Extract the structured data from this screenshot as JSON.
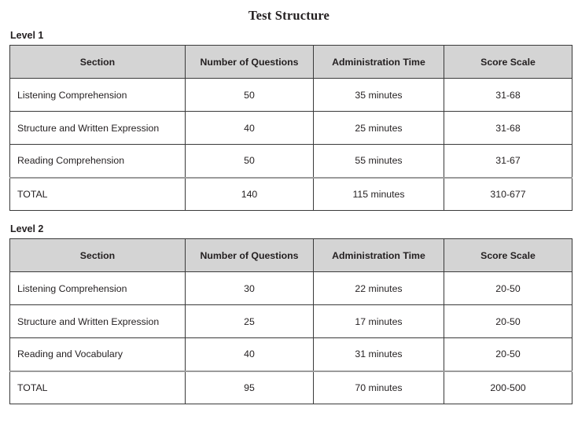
{
  "document": {
    "title": "Test Structure"
  },
  "colors": {
    "header_background": "#d4d4d4",
    "border": "#3a3a3a",
    "total_separator": "#9b9b9b",
    "text": "#231f20",
    "page_background": "#ffffff"
  },
  "columns": [
    "Section",
    "Number of Questions",
    "Administration Time",
    "Score Scale"
  ],
  "tables": [
    {
      "label": "Level 1",
      "headers": [
        "Section",
        "Number of Questions",
        "Administration Time",
        "Score Scale"
      ],
      "rows": [
        {
          "section": "Listening Comprehension",
          "questions": "50",
          "time": "35 minutes",
          "scale": "31-68"
        },
        {
          "section": "Structure and Written Expression",
          "questions": "40",
          "time": "25 minutes",
          "scale": "31-68"
        },
        {
          "section": "Reading Comprehension",
          "questions": "50",
          "time": "55 minutes",
          "scale": "31-67"
        }
      ],
      "total": {
        "section": "TOTAL",
        "questions": "140",
        "time": "115 minutes",
        "scale": "310-677"
      }
    },
    {
      "label": "Level 2",
      "headers": [
        "Section",
        "Number of Questions",
        "Administration Time",
        "Score Scale"
      ],
      "rows": [
        {
          "section": "Listening Comprehension",
          "questions": "30",
          "time": "22 minutes",
          "scale": "20-50"
        },
        {
          "section": "Structure and Written Expression",
          "questions": "25",
          "time": "17 minutes",
          "scale": "20-50"
        },
        {
          "section": "Reading and Vocabulary",
          "questions": "40",
          "time": "31 minutes",
          "scale": "20-50"
        }
      ],
      "total": {
        "section": "TOTAL",
        "questions": "95",
        "time": "70 minutes",
        "scale": "200-500"
      }
    }
  ]
}
